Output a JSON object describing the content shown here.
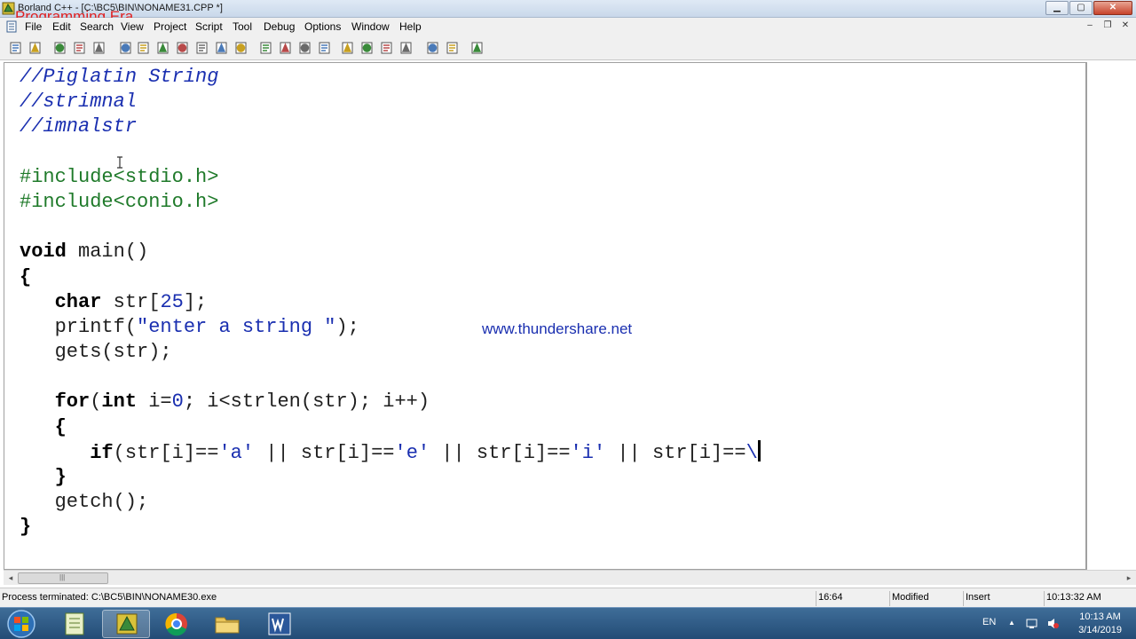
{
  "window": {
    "title": "Borland C++ - [C:\\BC5\\BIN\\NONAME31.CPP *]",
    "watermark": "Programming Era",
    "minimize_glyph": "▁",
    "maximize_glyph": "▢",
    "close_glyph": "✕"
  },
  "menu": {
    "items": [
      "File",
      "Edit",
      "Search",
      "View",
      "Project",
      "Script",
      "Tool",
      "Debug",
      "Options",
      "Window",
      "Help"
    ],
    "mdi_minimize": "‒",
    "mdi_restore": "❐",
    "mdi_close": "✕"
  },
  "toolbar": {
    "icons": [
      "new-file-icon",
      "open-file-icon",
      "save-icon",
      "save-all-icon",
      "print-icon",
      "find-icon",
      "replace-icon",
      "search-again-icon",
      "compile-icon",
      "make-icon",
      "build-icon",
      "run-icon",
      "stop-icon",
      "step-over-icon",
      "trace-into-icon",
      "breakpoint-icon",
      "inspect-icon",
      "undo-icon",
      "close-icon",
      "bookmark-icon",
      "browse-icon",
      "pointer-icon",
      "add-watch-icon",
      "evaluate-icon",
      "message-window-icon",
      "project-window-icon",
      "help-icon"
    ]
  },
  "editor": {
    "overlay_url": "www.thundershare.net",
    "lines": [
      {
        "parts": [
          {
            "t": "//Piglatin String",
            "k": "comment"
          }
        ]
      },
      {
        "parts": [
          {
            "t": "//strimnal",
            "k": "comment"
          }
        ]
      },
      {
        "parts": [
          {
            "t": "//imnalstr",
            "k": "comment"
          }
        ]
      },
      {
        "parts": []
      },
      {
        "parts": [
          {
            "t": "#include<stdio.h>",
            "k": "pre"
          }
        ]
      },
      {
        "parts": [
          {
            "t": "#include<conio.h>",
            "k": "pre"
          }
        ]
      },
      {
        "parts": []
      },
      {
        "parts": [
          {
            "t": "void",
            "k": "kw"
          },
          {
            "t": " main()",
            "k": "plain"
          }
        ]
      },
      {
        "parts": [
          {
            "t": "{",
            "k": "kw"
          }
        ]
      },
      {
        "parts": [
          {
            "t": "   ",
            "k": "plain"
          },
          {
            "t": "char",
            "k": "kw"
          },
          {
            "t": " str[",
            "k": "plain"
          },
          {
            "t": "25",
            "k": "num"
          },
          {
            "t": "];",
            "k": "plain"
          }
        ]
      },
      {
        "parts": [
          {
            "t": "   printf(",
            "k": "plain"
          },
          {
            "t": "\"enter a string \"",
            "k": "str"
          },
          {
            "t": ");",
            "k": "plain"
          }
        ]
      },
      {
        "parts": [
          {
            "t": "   gets(str);",
            "k": "plain"
          }
        ]
      },
      {
        "parts": []
      },
      {
        "parts": [
          {
            "t": "   ",
            "k": "plain"
          },
          {
            "t": "for",
            "k": "kw"
          },
          {
            "t": "(",
            "k": "plain"
          },
          {
            "t": "int",
            "k": "kw"
          },
          {
            "t": " i=",
            "k": "plain"
          },
          {
            "t": "0",
            "k": "num"
          },
          {
            "t": "; i<strlen(str); i++)",
            "k": "plain"
          }
        ]
      },
      {
        "parts": [
          {
            "t": "   {",
            "k": "kw"
          }
        ]
      },
      {
        "parts": [
          {
            "t": "      ",
            "k": "plain"
          },
          {
            "t": "if",
            "k": "kw"
          },
          {
            "t": "(str[i]==",
            "k": "plain"
          },
          {
            "t": "'a'",
            "k": "str"
          },
          {
            "t": " || str[i]==",
            "k": "plain"
          },
          {
            "t": "'e'",
            "k": "str"
          },
          {
            "t": " || str[i]==",
            "k": "plain"
          },
          {
            "t": "'i'",
            "k": "str"
          },
          {
            "t": " || str[i]==",
            "k": "plain"
          },
          {
            "t": "\\",
            "k": "str"
          }
        ],
        "caret": true
      },
      {
        "parts": [
          {
            "t": "   }",
            "k": "kw"
          }
        ]
      },
      {
        "parts": [
          {
            "t": "   getch();",
            "k": "plain"
          }
        ]
      },
      {
        "parts": [
          {
            "t": "}",
            "k": "kw"
          }
        ]
      }
    ]
  },
  "scrollbar": {
    "left_arrow": "◂",
    "right_arrow": "▸",
    "grip": "|||"
  },
  "statusbar": {
    "message": "Process terminated: C:\\BC5\\BIN\\NONAME30.exe",
    "position": "16:64",
    "modified": "Modified",
    "mode": "Insert",
    "time": "10:13:32 AM"
  },
  "taskbar": {
    "apps": [
      "windows-explorer-app",
      "notepad-app",
      "borland-cpp-app",
      "chrome-app",
      "file-explorer-app",
      "word-app"
    ],
    "language": "EN",
    "tray_up": "▲",
    "clock_time": "10:13 AM",
    "clock_date": "3/14/2019"
  }
}
